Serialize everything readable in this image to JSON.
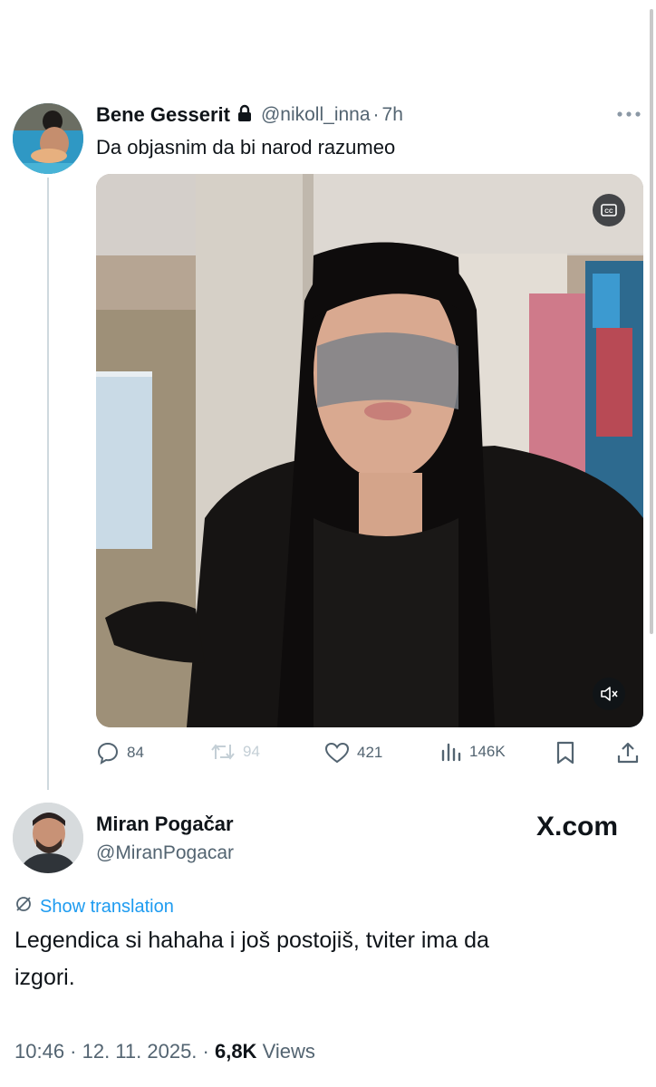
{
  "tweet": {
    "author_name": "Bene Gesserit",
    "handle": "@nikoll_inna",
    "separator": "·",
    "time": "7h",
    "text": "Da objasnim da bi narod razumeo",
    "stats": {
      "replies": "84",
      "retweets": "94",
      "likes": "421",
      "views": "146K"
    }
  },
  "reply": {
    "author_name": "Miran Pogačar",
    "handle": "@MiranPogacar",
    "watermark": "X.com",
    "translate_label": "Show translation",
    "text_line1": "Legendica si hahaha i još postojiš, tviter ima da",
    "text_line2": "izgori.",
    "meta_time": "10:46 · 12. 11. 2025. · ",
    "meta_views_count": "6,8K",
    "meta_views_label": " Views"
  },
  "icons": [
    "lock-icon",
    "more-icon",
    "cc-icon",
    "mute-icon",
    "reply-icon",
    "retweet-icon",
    "like-icon",
    "views-icon",
    "bookmark-icon",
    "share-icon",
    "translate-icon"
  ],
  "colors": {
    "accent": "#1d9bf0",
    "muted": "#536471",
    "text": "#0f1419",
    "retweet_disabled": "#a9b7c2"
  }
}
